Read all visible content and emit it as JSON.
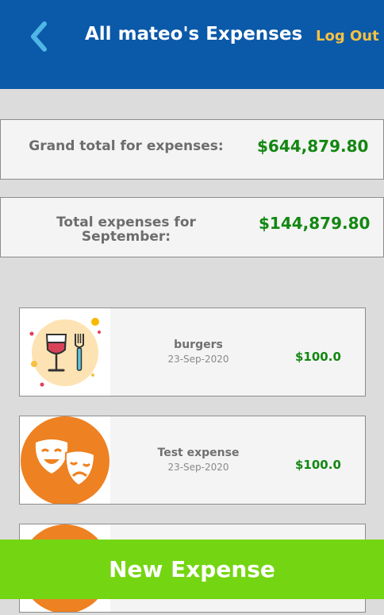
{
  "header": {
    "title": "All mateo's Expenses",
    "logout_label": "Log Out",
    "back_icon": "chevron-left-icon"
  },
  "summary": {
    "grand_total_label": "Grand total for expenses:",
    "grand_total_value": "$644,879.80",
    "month_total_label": "Total expenses for September:",
    "month_total_value": "$144,879.80"
  },
  "expenses": [
    {
      "name": "burgers",
      "date": "23-Sep-2020",
      "amount": "$100.0",
      "icon": "food-drink-icon"
    },
    {
      "name": "Test expense",
      "date": "23-Sep-2020",
      "amount": "$100.0",
      "icon": "theater-masks-icon"
    },
    {
      "icon": "theater-masks-icon"
    }
  ],
  "footer": {
    "new_expense_label": "New Expense"
  },
  "colors": {
    "header_bg": "#0b59a9",
    "logout": "#f6c142",
    "amount": "#138712",
    "new_button": "#74d612",
    "entertainment_icon": "#ee8121"
  }
}
